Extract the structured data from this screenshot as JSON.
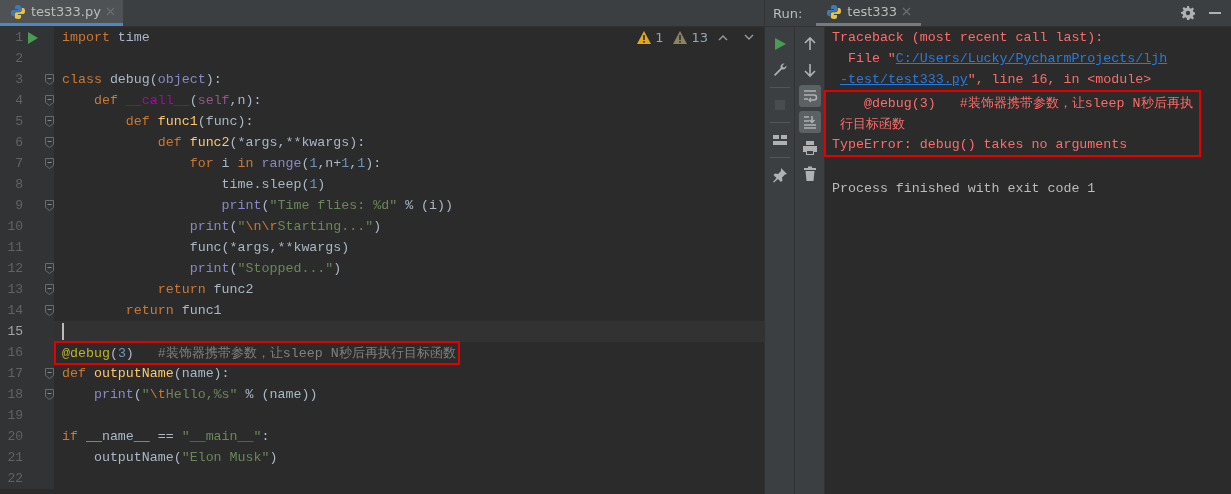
{
  "editor": {
    "tabs": [
      {
        "label": "test333.py",
        "selected": true
      }
    ],
    "inspections": {
      "warnings": "1",
      "weak_warnings": "13"
    },
    "lines": [
      {
        "number": "1",
        "run": true,
        "fold": false,
        "current": false,
        "boxed": false,
        "tokens": [
          {
            "kind": "kw",
            "text": "import"
          },
          {
            "kind": "plain",
            "text": " time"
          }
        ]
      },
      {
        "number": "2",
        "run": false,
        "fold": false,
        "current": false,
        "boxed": false
      },
      {
        "number": "3",
        "run": false,
        "fold": true,
        "current": false,
        "boxed": false,
        "tokens": [
          {
            "kind": "kw",
            "text": "class"
          },
          {
            "kind": "plain",
            "text": " debug("
          },
          {
            "kind": "builtin",
            "text": "object"
          },
          {
            "kind": "plain",
            "text": "):"
          }
        ]
      },
      {
        "number": "4",
        "run": false,
        "fold": true,
        "current": false,
        "boxed": false,
        "tokens": [
          {
            "kind": "kw",
            "text": "    def "
          },
          {
            "kind": "magic",
            "text": "__call__"
          },
          {
            "kind": "plain",
            "text": "("
          },
          {
            "kind": "self",
            "text": "self"
          },
          {
            "kind": "plain",
            "text": ",n):"
          }
        ]
      },
      {
        "number": "5",
        "run": false,
        "fold": true,
        "current": false,
        "boxed": false,
        "tokens": [
          {
            "kind": "kw",
            "text": "        def "
          },
          {
            "kind": "fn",
            "text": "func1"
          },
          {
            "kind": "plain",
            "text": "(func):"
          }
        ]
      },
      {
        "number": "6",
        "run": false,
        "fold": true,
        "current": false,
        "boxed": false,
        "tokens": [
          {
            "kind": "kw",
            "text": "            def "
          },
          {
            "kind": "fn",
            "text": "func2"
          },
          {
            "kind": "plain",
            "text": "(*args,**kwargs):"
          }
        ]
      },
      {
        "number": "7",
        "run": false,
        "fold": true,
        "current": false,
        "boxed": false,
        "tokens": [
          {
            "kind": "kw",
            "text": "                for"
          },
          {
            "kind": "plain",
            "text": " i "
          },
          {
            "kind": "kw",
            "text": "in "
          },
          {
            "kind": "builtin",
            "text": "range"
          },
          {
            "kind": "plain",
            "text": "("
          },
          {
            "kind": "num",
            "text": "1"
          },
          {
            "kind": "plain",
            "text": ",n+"
          },
          {
            "kind": "num",
            "text": "1"
          },
          {
            "kind": "plain",
            "text": ","
          },
          {
            "kind": "num",
            "text": "1"
          },
          {
            "kind": "plain",
            "text": "):"
          }
        ]
      },
      {
        "number": "8",
        "run": false,
        "fold": false,
        "current": false,
        "boxed": false,
        "tokens": [
          {
            "kind": "plain",
            "text": "                    time.sleep("
          },
          {
            "kind": "num",
            "text": "1"
          },
          {
            "kind": "plain",
            "text": ")"
          }
        ]
      },
      {
        "number": "9",
        "run": false,
        "fold": true,
        "current": false,
        "boxed": false,
        "tokens": [
          {
            "kind": "builtin",
            "text": "                    print"
          },
          {
            "kind": "plain",
            "text": "("
          },
          {
            "kind": "str",
            "text": "\"Time flies: %d\""
          },
          {
            "kind": "plain",
            "text": " % (i))"
          }
        ]
      },
      {
        "number": "10",
        "run": false,
        "fold": false,
        "current": false,
        "boxed": false,
        "tokens": [
          {
            "kind": "builtin",
            "text": "                print"
          },
          {
            "kind": "plain",
            "text": "("
          },
          {
            "kind": "str",
            "text": "\""
          },
          {
            "kind": "esc",
            "text": "\\n\\r"
          },
          {
            "kind": "str",
            "text": "Starting...\""
          },
          {
            "kind": "plain",
            "text": ")"
          }
        ]
      },
      {
        "number": "11",
        "run": false,
        "fold": false,
        "current": false,
        "boxed": false,
        "tokens": [
          {
            "kind": "plain",
            "text": "                func(*args,**kwargs)"
          }
        ]
      },
      {
        "number": "12",
        "run": false,
        "fold": true,
        "current": false,
        "boxed": false,
        "tokens": [
          {
            "kind": "builtin",
            "text": "                print"
          },
          {
            "kind": "plain",
            "text": "("
          },
          {
            "kind": "str",
            "text": "\"Stopped...\""
          },
          {
            "kind": "plain",
            "text": ")"
          }
        ]
      },
      {
        "number": "13",
        "run": false,
        "fold": true,
        "current": false,
        "boxed": false,
        "tokens": [
          {
            "kind": "kw",
            "text": "            return"
          },
          {
            "kind": "plain",
            "text": " func2"
          }
        ]
      },
      {
        "number": "14",
        "run": false,
        "fold": true,
        "current": false,
        "boxed": false,
        "tokens": [
          {
            "kind": "kw",
            "text": "        return"
          },
          {
            "kind": "plain",
            "text": " func1"
          }
        ]
      },
      {
        "number": "15",
        "run": false,
        "fold": false,
        "current": true,
        "boxed": false
      },
      {
        "number": "16",
        "run": false,
        "fold": false,
        "current": false,
        "boxed": true,
        "tokens": [
          {
            "kind": "deco",
            "text": "@debug"
          },
          {
            "kind": "plain",
            "text": "("
          },
          {
            "kind": "num",
            "text": "3"
          },
          {
            "kind": "plain",
            "text": ")   "
          },
          {
            "kind": "comment",
            "text": "#装饰器携带参数，让sleep N秒后再执行目标函数"
          }
        ]
      },
      {
        "number": "17",
        "run": false,
        "fold": true,
        "current": false,
        "boxed": false,
        "tokens": [
          {
            "kind": "kw",
            "text": "def "
          },
          {
            "kind": "fn",
            "text": "outputName"
          },
          {
            "kind": "plain",
            "text": "(name):"
          }
        ]
      },
      {
        "number": "18",
        "run": false,
        "fold": true,
        "current": false,
        "boxed": false,
        "tokens": [
          {
            "kind": "builtin",
            "text": "    print"
          },
          {
            "kind": "plain",
            "text": "("
          },
          {
            "kind": "str",
            "text": "\""
          },
          {
            "kind": "esc",
            "text": "\\t"
          },
          {
            "kind": "str",
            "text": "Hello,%s\""
          },
          {
            "kind": "plain",
            "text": " % (name))"
          }
        ]
      },
      {
        "number": "19",
        "run": false,
        "fold": false,
        "current": false,
        "boxed": false
      },
      {
        "number": "20",
        "run": false,
        "fold": false,
        "current": false,
        "boxed": false,
        "tokens": [
          {
            "kind": "kw",
            "text": "if"
          },
          {
            "kind": "plain",
            "text": " __name__ == "
          },
          {
            "kind": "str",
            "text": "\"__main__\""
          },
          {
            "kind": "plain",
            "text": ":"
          }
        ]
      },
      {
        "number": "21",
        "run": false,
        "fold": false,
        "current": false,
        "boxed": false,
        "tokens": [
          {
            "kind": "plain",
            "text": "    outputName("
          },
          {
            "kind": "str",
            "text": "\"Elon Musk\""
          },
          {
            "kind": "plain",
            "text": ")"
          }
        ]
      },
      {
        "number": "22",
        "run": false,
        "fold": false,
        "current": false,
        "boxed": false
      }
    ]
  },
  "run": {
    "label": "Run:",
    "tabs": [
      {
        "label": "test333",
        "selected": true
      }
    ],
    "toolbar_left": [
      {
        "kind": "run",
        "disabled": false
      },
      {
        "kind": "wrench",
        "disabled": false
      },
      {
        "kind": "sep"
      },
      {
        "kind": "stop",
        "disabled": true
      },
      {
        "kind": "sep"
      },
      {
        "kind": "layout",
        "disabled": false
      },
      {
        "kind": "sep"
      },
      {
        "kind": "pin",
        "disabled": false
      }
    ],
    "toolbar_right": [
      {
        "kind": "up",
        "on": false
      },
      {
        "kind": "down",
        "on": false
      },
      {
        "kind": "wrap",
        "on": true
      },
      {
        "kind": "scrollend",
        "on": true
      },
      {
        "kind": "print",
        "on": false
      },
      {
        "kind": "trash",
        "on": false
      }
    ],
    "console": [
      {
        "boxed": false,
        "segments": [
          {
            "kind": "error",
            "text": "Traceback (most recent call last):"
          }
        ]
      },
      {
        "boxed": false,
        "segments": [
          {
            "kind": "error",
            "text": "  File \""
          },
          {
            "kind": "link",
            "text": "C:/Users/Lucky/PycharmProjects/ljh"
          }
        ]
      },
      {
        "boxed": false,
        "segments": [
          {
            "kind": "link",
            "text": "-test/test333.py"
          },
          {
            "kind": "error",
            "text": "\", line 16, in <module>"
          }
        ]
      },
      {
        "boxed": true,
        "segments": [
          {
            "kind": "error",
            "text": "    @debug(3)   #装饰器携带参数，让sleep N秒后再执"
          }
        ]
      },
      {
        "boxed": true,
        "segments": [
          {
            "kind": "error",
            "text": "行目标函数"
          }
        ]
      },
      {
        "boxed": true,
        "segments": [
          {
            "kind": "error",
            "text": "TypeError: debug() takes no arguments"
          }
        ]
      },
      {
        "boxed": false
      },
      {
        "boxed": false,
        "segments": [
          {
            "kind": "normal",
            "text": "Process finished with exit code 1"
          }
        ]
      }
    ]
  }
}
